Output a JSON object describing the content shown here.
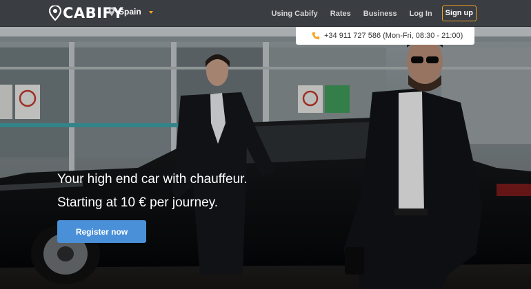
{
  "brand": {
    "logo_text": "CABIFY"
  },
  "region": {
    "label": "Spain"
  },
  "nav": {
    "using": "Using Cabify",
    "rates": "Rates",
    "business": "Business",
    "login": "Log In",
    "signup": "Sign up"
  },
  "contact": {
    "phone": "+34 911 727 586 (Mon-Fri, 08:30 - 21:00)"
  },
  "hero": {
    "headline": "Your high end car with chauffeur.",
    "subline": "Starting at 10 € per journey.",
    "cta": "Register now"
  },
  "colors": {
    "accent": "#f5a623",
    "cta": "#4a90d9",
    "header": "#3a3d41"
  }
}
